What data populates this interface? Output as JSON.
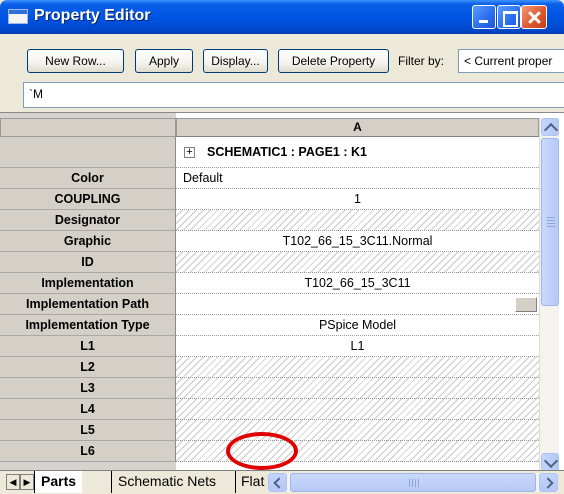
{
  "window": {
    "title": "Property Editor"
  },
  "toolbar": {
    "new_row_label": "New Row...",
    "apply_label": "Apply",
    "display_label": "Display...",
    "delete_property_label": "Delete Property",
    "filter_label": "Filter by:",
    "filter_value": "< Current proper"
  },
  "editline": {
    "value": "`M"
  },
  "grid": {
    "column_header": "A",
    "group_label": "SCHEMATIC1 : PAGE1 : K1",
    "expand_symbol": "+",
    "rows": [
      {
        "name": "Color",
        "value": "Default"
      },
      {
        "name": "COUPLING",
        "value": "1"
      },
      {
        "name": "Designator",
        "value": ""
      },
      {
        "name": "Graphic",
        "value": "T102_66_15_3C11.Normal"
      },
      {
        "name": "ID",
        "value": ""
      },
      {
        "name": "Implementation",
        "value": "T102_66_15_3C11"
      },
      {
        "name": "Implementation Path",
        "value": ""
      },
      {
        "name": "Implementation Type",
        "value": "PSpice Model"
      },
      {
        "name": "L1",
        "value": "L1"
      },
      {
        "name": "L2",
        "value": ""
      },
      {
        "name": "L3",
        "value": ""
      },
      {
        "name": "L4",
        "value": ""
      },
      {
        "name": "L5",
        "value": ""
      },
      {
        "name": "L6",
        "value": ""
      }
    ]
  },
  "tabs": {
    "prev_symbol": "◀",
    "next_symbol": "▶",
    "parts": "Parts",
    "schematic_nets": "Schematic Nets",
    "flat": "Flat"
  },
  "colors": {
    "titlebar": "#0054e3",
    "annotation": "#e00000"
  }
}
